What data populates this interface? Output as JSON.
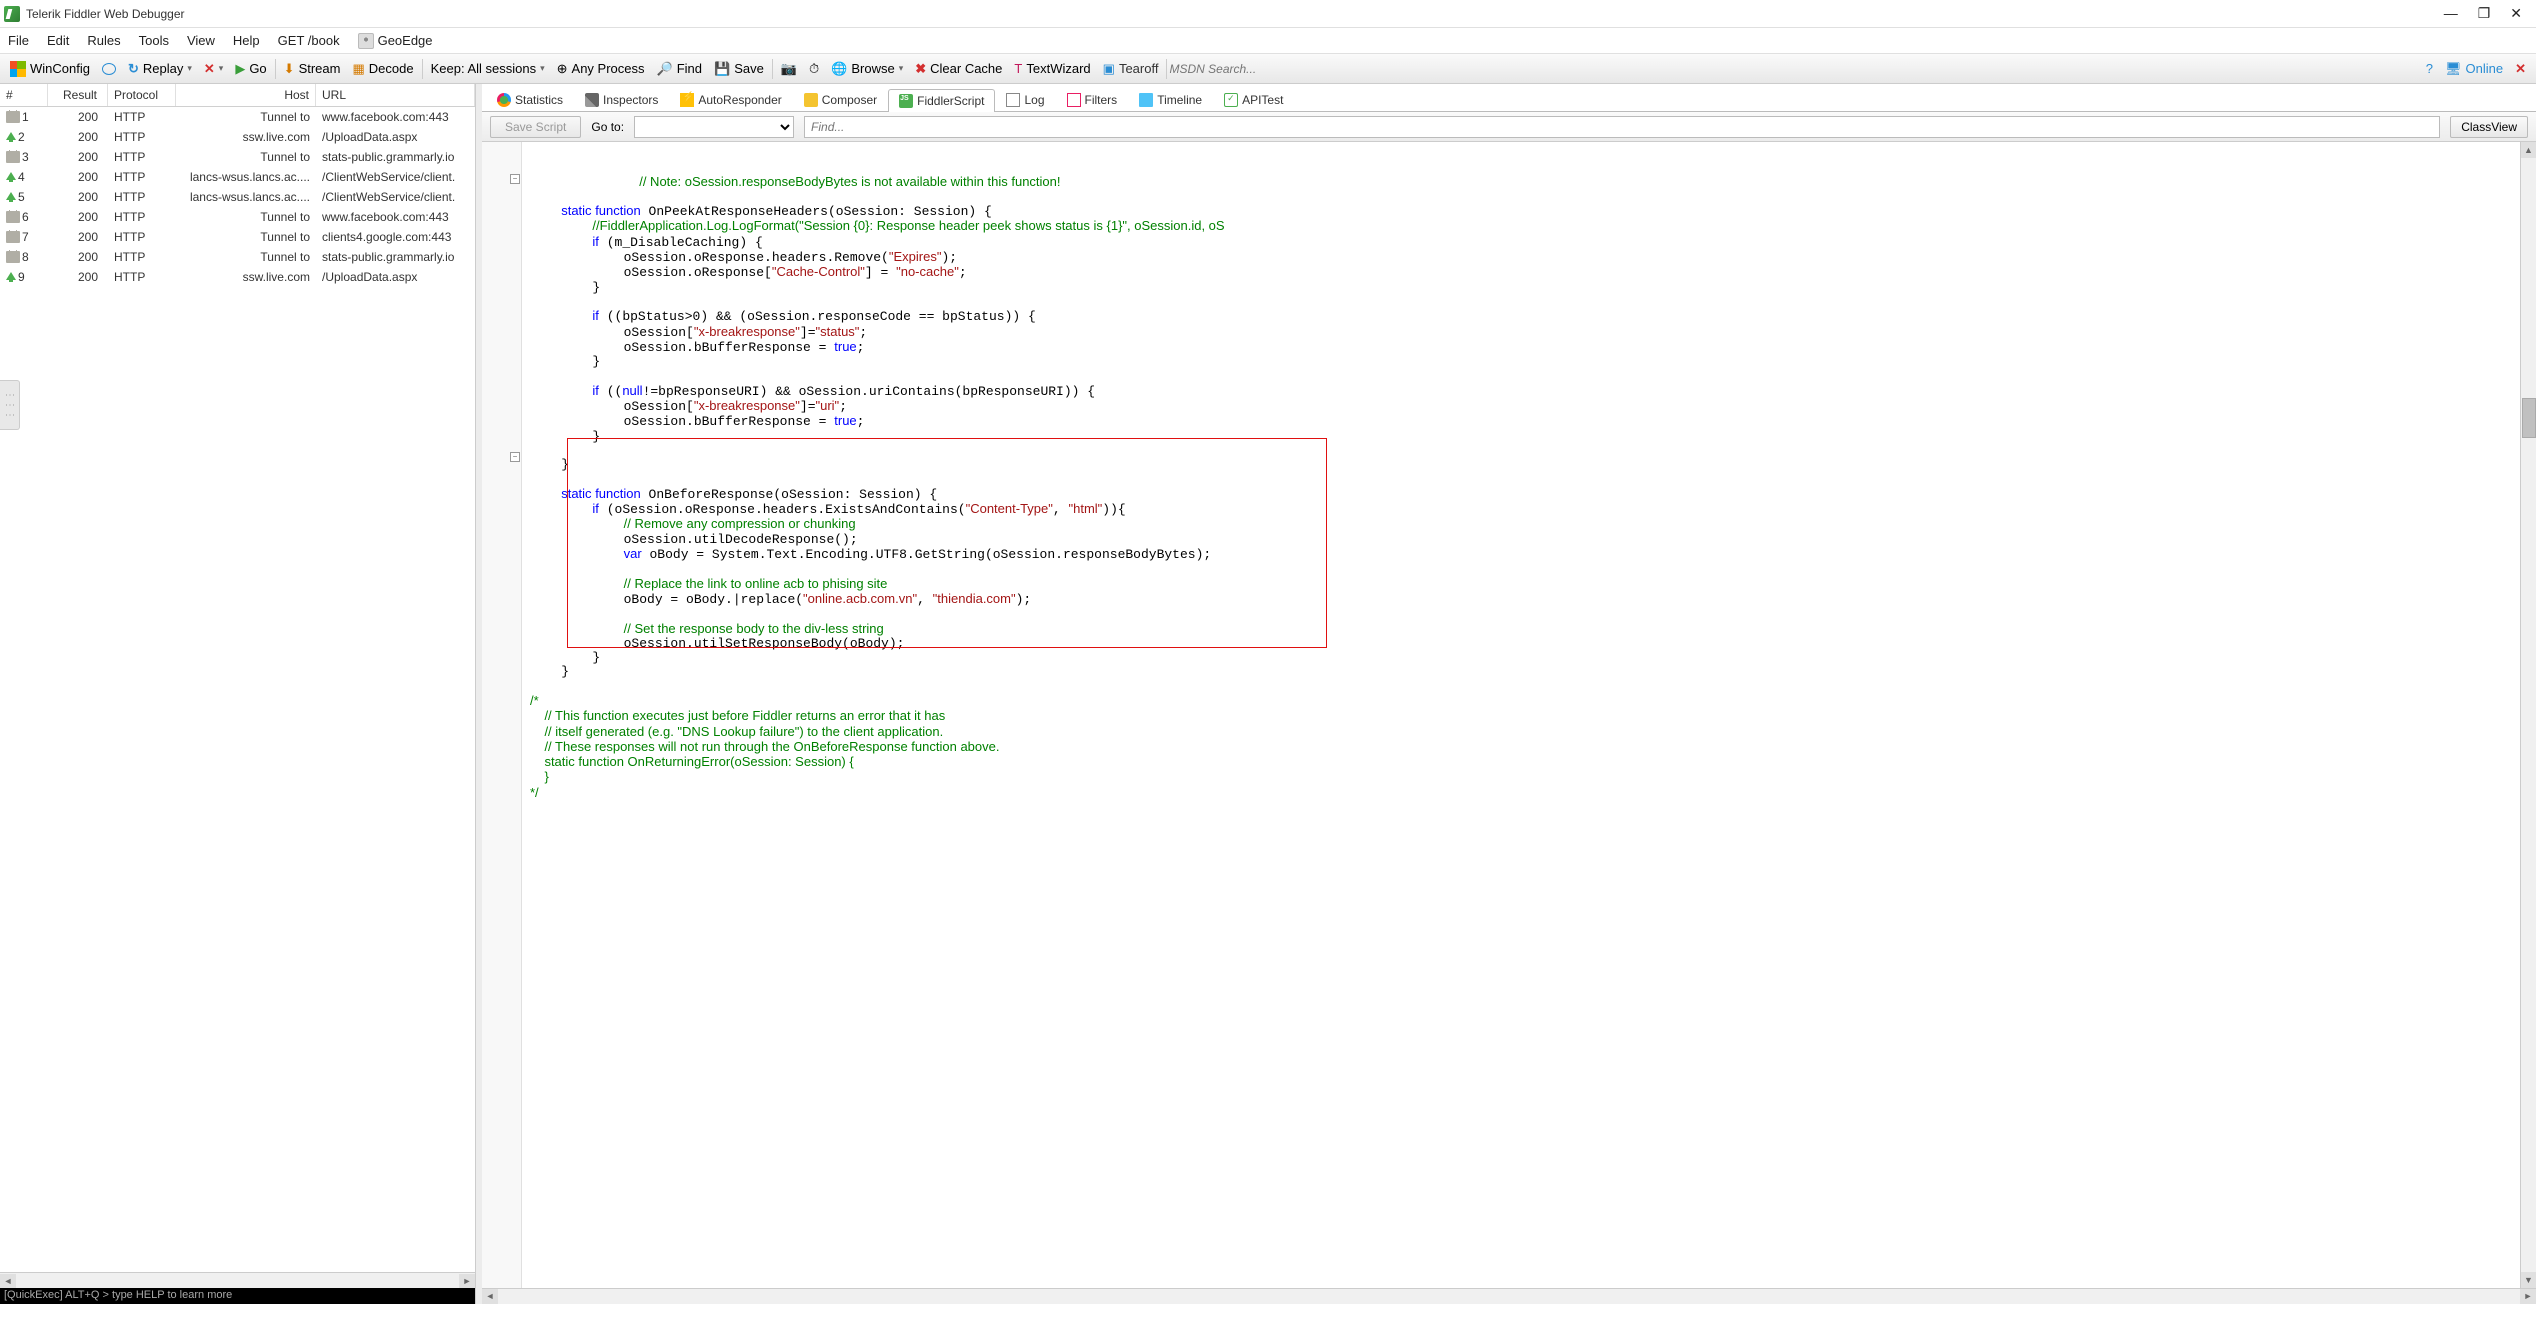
{
  "title": "Telerik Fiddler Web Debugger",
  "menu": {
    "file": "File",
    "edit": "Edit",
    "rules": "Rules",
    "tools": "Tools",
    "view": "View",
    "help": "Help",
    "getbook": "GET /book",
    "geoedge": "GeoEdge"
  },
  "toolbar": {
    "winconfig": "WinConfig",
    "replay": "Replay",
    "go": "Go",
    "stream": "Stream",
    "decode": "Decode",
    "keep": "Keep: All sessions",
    "anyproc": "Any Process",
    "find": "Find",
    "save": "Save",
    "browse": "Browse",
    "clearcache": "Clear Cache",
    "textwiz": "TextWizard",
    "tearoff": "Tearoff",
    "msdn": "MSDN Search...",
    "online": "Online"
  },
  "sessions": {
    "cols": {
      "num": "#",
      "result": "Result",
      "protocol": "Protocol",
      "host": "Host",
      "url": "URL"
    },
    "rows": [
      {
        "n": "1",
        "ico": "lock",
        "res": "200",
        "prot": "HTTP",
        "host": "Tunnel to",
        "url": "www.facebook.com:443"
      },
      {
        "n": "2",
        "ico": "up",
        "res": "200",
        "prot": "HTTP",
        "host": "ssw.live.com",
        "url": "/UploadData.aspx"
      },
      {
        "n": "3",
        "ico": "lock",
        "res": "200",
        "prot": "HTTP",
        "host": "Tunnel to",
        "url": "stats-public.grammarly.io"
      },
      {
        "n": "4",
        "ico": "up",
        "res": "200",
        "prot": "HTTP",
        "host": "lancs-wsus.lancs.ac....",
        "url": "/ClientWebService/client."
      },
      {
        "n": "5",
        "ico": "up",
        "res": "200",
        "prot": "HTTP",
        "host": "lancs-wsus.lancs.ac....",
        "url": "/ClientWebService/client."
      },
      {
        "n": "6",
        "ico": "lock",
        "res": "200",
        "prot": "HTTP",
        "host": "Tunnel to",
        "url": "www.facebook.com:443"
      },
      {
        "n": "7",
        "ico": "lock",
        "res": "200",
        "prot": "HTTP",
        "host": "Tunnel to",
        "url": "clients4.google.com:443"
      },
      {
        "n": "8",
        "ico": "lock",
        "res": "200",
        "prot": "HTTP",
        "host": "Tunnel to",
        "url": "stats-public.grammarly.io"
      },
      {
        "n": "9",
        "ico": "up",
        "res": "200",
        "prot": "HTTP",
        "host": "ssw.live.com",
        "url": "/UploadData.aspx"
      }
    ]
  },
  "quickexec": "[QuickExec] ALT+Q > type HELP to learn more",
  "tabs": {
    "stats": "Statistics",
    "insp": "Inspectors",
    "auto": "AutoResponder",
    "comp": "Composer",
    "fs": "FiddlerScript",
    "log": "Log",
    "filt": "Filters",
    "tl": "Timeline",
    "api": "APITest"
  },
  "scriptbar": {
    "save": "Save Script",
    "goto": "Go to:",
    "find": "Find...",
    "classview": "ClassView"
  },
  "code": {
    "l1": "// Note: oSession.responseBodyBytes is not available within this function!",
    "l2a": "static ",
    "l2b": "function",
    "l2c": " OnPeekAtResponseHeaders(oSession: Session) {",
    "l3": "//FiddlerApplication.Log.LogFormat(\"Session {0}: Response header peek shows status is {1}\", oSession.id, oS",
    "l4a": "if",
    "l4b": " (m_DisableCaching) {",
    "l5a": "oSession.oResponse.headers.Remove(",
    "l5b": "\"Expires\"",
    "l5c": ");",
    "l6a": "oSession.oResponse[",
    "l6b": "\"Cache-Control\"",
    "l6c": "] = ",
    "l6d": "\"no-cache\"",
    "l6e": ";",
    "l7": "}",
    "l8a": "if",
    "l8b": " ((bpStatus>0) && (oSession.responseCode == bpStatus)) {",
    "l9a": "oSession[",
    "l9b": "\"x-breakresponse\"",
    "l9c": "]=",
    "l9d": "\"status\"",
    "l9e": ";",
    "l10a": "oSession.bBufferResponse = ",
    "l10b": "true",
    "l10c": ";",
    "l11": "}",
    "l12a": "if",
    "l12b": " ((",
    "l12c": "null",
    "l12d": "!=bpResponseURI) && oSession.uriContains(bpResponseURI)) {",
    "l13a": "oSession[",
    "l13b": "\"x-breakresponse\"",
    "l13c": "]=",
    "l13d": "\"uri\"",
    "l13e": ";",
    "l14a": "oSession.bBufferResponse = ",
    "l14b": "true",
    "l14c": ";",
    "l15": "}",
    "l16": "}",
    "l17a": "static ",
    "l17b": "function",
    "l17c": " OnBeforeResponse(oSession: Session) {",
    "l18a": "if",
    "l18b": " (oSession.oResponse.headers.ExistsAndContains(",
    "l18c": "\"Content-Type\"",
    "l18d": ", ",
    "l18e": "\"html\"",
    "l18f": ")){",
    "l19": "// Remove any compression or chunking",
    "l20": "oSession.utilDecodeResponse();",
    "l21a": "var",
    "l21b": " oBody = System.Text.Encoding.UTF8.GetString(oSession.responseBodyBytes);",
    "l22": "// Replace the link to online acb to phising site",
    "l23a": "oBody = oBody.|replace(",
    "l23b": "\"online.acb.com.vn\"",
    "l23c": ", ",
    "l23d": "\"thiendia.com\"",
    "l23e": ");",
    "l24": "// Set the response body to the div-less string",
    "l25": "oSession.utilSetResponseBody(oBody);",
    "l26": "}",
    "l27": "}",
    "l28": "/*",
    "l29": "// This function executes just before Fiddler returns an error that it has",
    "l30": "// itself generated (e.g. \"DNS Lookup failure\") to the client application.",
    "l31": "// These responses will not run through the OnBeforeResponse function above.",
    "l32": "static function OnReturningError(oSession: Session) {",
    "l33": "}",
    "l34": "*/"
  }
}
